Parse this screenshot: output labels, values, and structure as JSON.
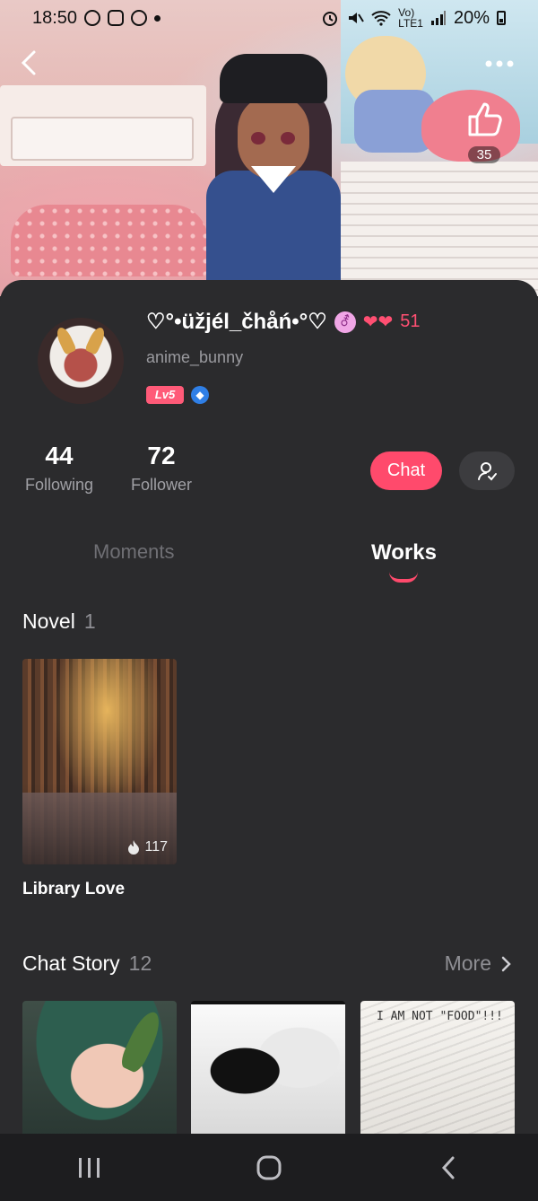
{
  "status_bar": {
    "time": "18:50",
    "network_label": "Vo)\nLTE1",
    "battery": "20%"
  },
  "header": {
    "like_count": "35"
  },
  "profile": {
    "nickname": "♡°•üžjél_čhåń•°♡",
    "gender_symbol": "⚦",
    "hearts_count": "51",
    "username": "anime_bunny",
    "level": "Lv5",
    "following_count": "44",
    "following_label": "Following",
    "follower_count": "72",
    "follower_label": "Follower",
    "chat_label": "Chat"
  },
  "tabs": [
    {
      "label": "Moments",
      "active": false
    },
    {
      "label": "Works",
      "active": true
    }
  ],
  "novel_section": {
    "title": "Novel",
    "count": "1",
    "items": [
      {
        "title": "Library Love",
        "views": "117"
      }
    ]
  },
  "chat_story_section": {
    "title": "Chat Story",
    "count": "12",
    "more_label": "More",
    "thumb_caption": "I AM NOT \"FOOD\"!!!"
  },
  "colors": {
    "accent": "#ff4a6c",
    "background": "#2b2b2d",
    "muted_text": "#9a9a9f"
  }
}
